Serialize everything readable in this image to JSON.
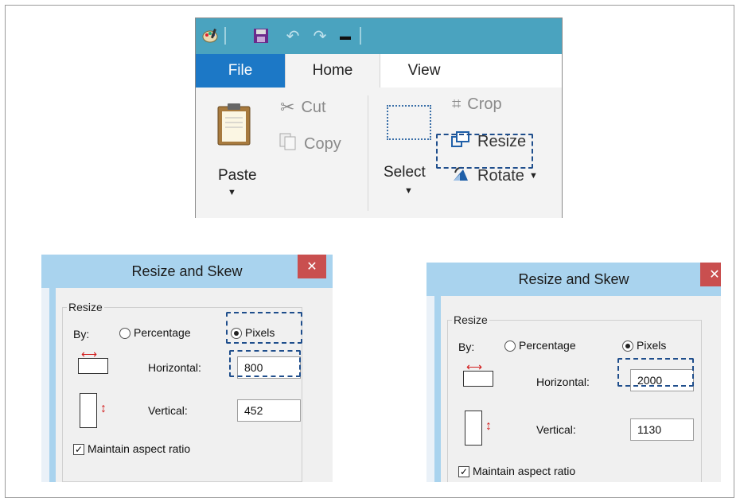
{
  "ribbon": {
    "tabs": {
      "file": "File",
      "home": "Home",
      "view": "View"
    },
    "clipboard": {
      "paste": "Paste",
      "cut": "Cut",
      "copy": "Copy"
    },
    "image": {
      "select": "Select",
      "crop": "Crop",
      "resize": "Resize",
      "rotate": "Rotate"
    }
  },
  "dialog_left": {
    "title": "Resize and Skew",
    "close": "✕",
    "group": "Resize",
    "by": "By:",
    "percentage": "Percentage",
    "pixels": "Pixels",
    "selected_unit": "Pixels",
    "horizontal_label": "Horizontal:",
    "horizontal_value": "800",
    "vertical_label": "Vertical:",
    "vertical_value": "452",
    "maintain": "Maintain aspect ratio",
    "maintain_checked": true
  },
  "dialog_right": {
    "title": "Resize and Skew",
    "close": "✕",
    "group": "Resize",
    "by": "By:",
    "percentage": "Percentage",
    "pixels": "Pixels",
    "selected_unit": "Pixels",
    "horizontal_label": "Horizontal:",
    "horizontal_value": "2000",
    "vertical_label": "Vertical:",
    "vertical_value": "1130",
    "maintain": "Maintain aspect ratio",
    "maintain_checked": true
  },
  "colors": {
    "titlebar": "#a9d3ee",
    "file_tab": "#1c78c6",
    "qat": "#4aa3bf",
    "highlight": "#1f4e8c",
    "arrow": "#d21f1f"
  }
}
